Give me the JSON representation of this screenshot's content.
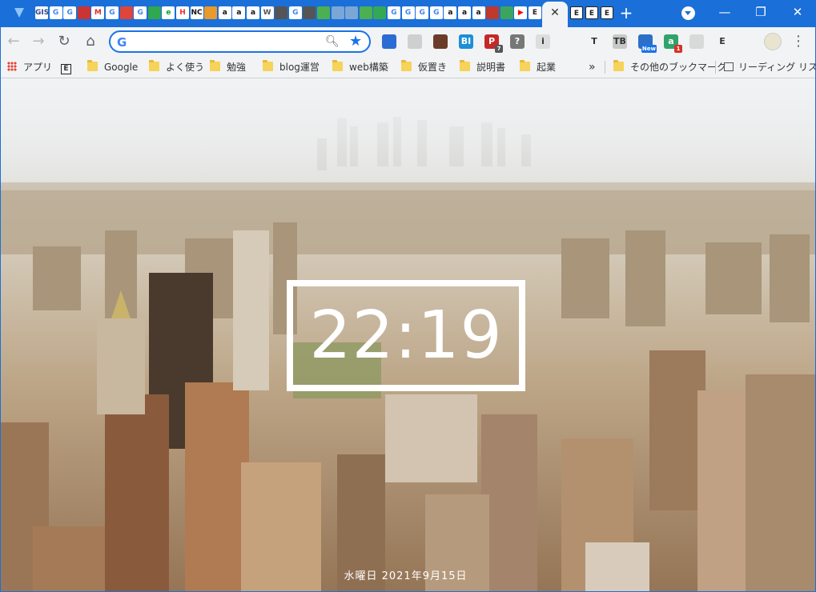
{
  "tabs": {
    "favicons": [
      {
        "name": "gis-tab-icon",
        "text": "GIS",
        "color": "#2d4a8a"
      },
      {
        "name": "google-tab-icon",
        "text": "G",
        "color": "#4285f4"
      },
      {
        "name": "google-tab-icon",
        "text": "G",
        "color": "#4285f4"
      },
      {
        "name": "app-tab-icon",
        "text": "",
        "color": "#cc3333"
      },
      {
        "name": "gmail-tab-icon",
        "text": "M",
        "color": "#d93025"
      },
      {
        "name": "google-tab-icon",
        "text": "G",
        "color": "#4285f4"
      },
      {
        "name": "train-tab-icon",
        "text": "",
        "color": "#e0453b"
      },
      {
        "name": "google-tab-icon",
        "text": "G",
        "color": "#4285f4"
      },
      {
        "name": "app-tab-icon",
        "text": "",
        "color": "#2fa84f"
      },
      {
        "name": "evernote-tab-icon",
        "text": "e",
        "color": "#00a82d"
      },
      {
        "name": "hotpepper-tab-icon",
        "text": "H",
        "color": "#e8342b"
      },
      {
        "name": "nc-tab-icon",
        "text": "NC",
        "color": "#111111"
      },
      {
        "name": "app-tab-icon",
        "text": "",
        "color": "#e89a2c"
      },
      {
        "name": "amazon-tab-icon",
        "text": "a",
        "color": "#111111"
      },
      {
        "name": "amazon-tab-icon",
        "text": "a",
        "color": "#111111"
      },
      {
        "name": "amazon-tab-icon",
        "text": "a",
        "color": "#111111"
      },
      {
        "name": "wikipedia-tab-icon",
        "text": "W",
        "color": "#555555"
      },
      {
        "name": "app-tab-icon",
        "text": "",
        "color": "#555555"
      },
      {
        "name": "google-tab-icon",
        "text": "G",
        "color": "#4285f4"
      },
      {
        "name": "app-tab-icon",
        "text": "",
        "color": "#555555"
      },
      {
        "name": "map-tab-icon",
        "text": "",
        "color": "#4caf50"
      },
      {
        "name": "doc-tab-icon",
        "text": "",
        "color": "#7aa7d6"
      },
      {
        "name": "doc-tab-icon",
        "text": "",
        "color": "#7aa7d6"
      },
      {
        "name": "map-tab-icon",
        "text": "",
        "color": "#4caf50"
      },
      {
        "name": "maps-tab-icon",
        "text": "",
        "color": "#34a853"
      },
      {
        "name": "google-tab-icon",
        "text": "G",
        "color": "#4285f4"
      },
      {
        "name": "google-tab-icon",
        "text": "G",
        "color": "#4285f4"
      },
      {
        "name": "google-tab-icon",
        "text": "G",
        "color": "#4285f4"
      },
      {
        "name": "google-tab-icon",
        "text": "G",
        "color": "#4285f4"
      },
      {
        "name": "amazon-tab-icon",
        "text": "a",
        "color": "#111111"
      },
      {
        "name": "amazon-tab-icon",
        "text": "a",
        "color": "#111111"
      },
      {
        "name": "amazon-tab-icon",
        "text": "a",
        "color": "#111111"
      },
      {
        "name": "app-tab-icon",
        "text": "",
        "color": "#c0392b"
      },
      {
        "name": "app-tab-icon",
        "text": "",
        "color": "#3ba55d"
      },
      {
        "name": "youtube-tab-icon",
        "text": "▶",
        "color": "#ff0000"
      },
      {
        "name": "e-tab-icon",
        "text": "E",
        "color": "#222222"
      }
    ],
    "after_active": [
      {
        "name": "e-tab-icon",
        "text": "E",
        "color": "#222222"
      },
      {
        "name": "e-tab-icon",
        "text": "E",
        "color": "#222222"
      },
      {
        "name": "e-tab-icon",
        "text": "E",
        "color": "#222222"
      }
    ],
    "active_close": "✕",
    "new_tab": "+"
  },
  "window_controls": {
    "minimize": "—",
    "restore": "❐",
    "close": "✕"
  },
  "toolbar": {
    "back": "←",
    "forward": "→",
    "reload": "↻",
    "home": "⌂",
    "omnibox": {
      "icon": "G",
      "value": "",
      "placeholder": ""
    },
    "extensions": [
      {
        "name": "vivaldi-extension-icon",
        "text": "",
        "color": "#2b6cd4",
        "badge": ""
      },
      {
        "name": "extension-icon",
        "text": "",
        "color": "#cfcfcf",
        "badge": ""
      },
      {
        "name": "coffee-extension-icon",
        "text": "",
        "color": "#6b3b2a",
        "badge": ""
      },
      {
        "name": "bi-extension-icon",
        "text": "BI",
        "color": "#1c8fd6",
        "badge": ""
      },
      {
        "name": "p-extension-icon",
        "text": "P",
        "color": "#c62828",
        "badge": "7"
      },
      {
        "name": "help-extension-icon",
        "text": "?",
        "color": "#777777",
        "badge": ""
      },
      {
        "name": "info-extension-icon",
        "text": "i",
        "color": "#dddddd",
        "badge": ""
      },
      {
        "name": "bookmark-extension-icon",
        "text": "",
        "color": "#f1f3f4",
        "badge": ""
      },
      {
        "name": "t-extension-icon",
        "text": "T",
        "color": "#f1f3f4",
        "badge": ""
      },
      {
        "name": "tb-extension-icon",
        "text": "TB",
        "color": "#c8c8c8",
        "badge": ""
      },
      {
        "name": "new-extension-icon",
        "text": "",
        "color": "#2c6fc9",
        "badge": "New"
      },
      {
        "name": "a-extension-icon",
        "text": "a",
        "color": "#2fa36b",
        "badge": "1"
      },
      {
        "name": "wifi-extension-icon",
        "text": "",
        "color": "#d9d9d9",
        "badge": ""
      },
      {
        "name": "e-extension-icon",
        "text": "E",
        "color": "#f1f3f4",
        "badge": ""
      },
      {
        "name": "puzzle-extension-icon",
        "text": "",
        "color": "#f1f3f4",
        "badge": ""
      }
    ],
    "menu": "⋮"
  },
  "bookmarks": {
    "apps_label": "アプリ",
    "items": [
      {
        "label": "Google",
        "type": "folder"
      },
      {
        "label": "よく使う",
        "type": "folder"
      },
      {
        "label": "勉強",
        "type": "folder"
      },
      {
        "label": "blog運営",
        "type": "folder"
      },
      {
        "label": "web構築",
        "type": "folder"
      },
      {
        "label": "仮置き",
        "type": "folder"
      },
      {
        "label": "説明書",
        "type": "folder"
      },
      {
        "label": "起業",
        "type": "folder"
      }
    ],
    "overflow": "»",
    "other_bookmarks": "その他のブックマーク",
    "reading_list": "リーディング リスト"
  },
  "newtab": {
    "time": "22:19",
    "date": "水曜日 2021年9月15日"
  }
}
